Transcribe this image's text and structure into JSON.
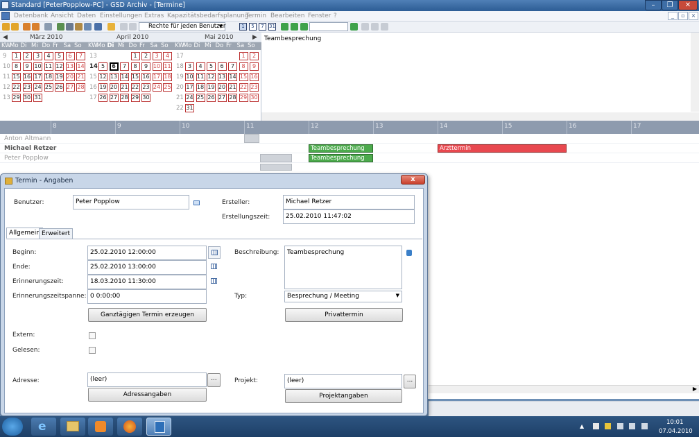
{
  "window": {
    "title": "Standard [PeterPopplow-PC] - GSD Archiv - [Termine]"
  },
  "menu": [
    "Datenbank",
    "Ansicht",
    "Daten",
    "Einstellungen",
    "Extras",
    "Kapazitätsbedarfsplanung",
    "Termin",
    "Bearbeiten",
    "Fenster",
    "?"
  ],
  "toolbar": {
    "rights_combo": "Rechte für jeden Benutzer",
    "view_buttons": [
      "1",
      "5",
      "7",
      "31"
    ]
  },
  "calendar": {
    "months": [
      "März 2010",
      "April 2010",
      "Mai 2010"
    ],
    "dow": [
      "KW",
      "Mo",
      "Di",
      "Mi",
      "Do",
      "Fr",
      "Sa",
      "So"
    ],
    "march": {
      "weeks": [
        "9",
        "10",
        "11",
        "12",
        "13"
      ],
      "rows": [
        [
          "",
          "1",
          "2",
          "3",
          "4",
          "5",
          "6",
          "7"
        ],
        [
          "",
          "8",
          "9",
          "10",
          "11",
          "12",
          "13",
          "14"
        ],
        [
          "",
          "15",
          "16",
          "17",
          "18",
          "19",
          "20",
          "21"
        ],
        [
          "",
          "22",
          "23",
          "24",
          "25",
          "26",
          "27",
          "28"
        ],
        [
          "",
          "29",
          "30",
          "31",
          "",
          "",
          "",
          ""
        ]
      ]
    },
    "april": {
      "weeks": [
        "13",
        "14",
        "15",
        "16",
        "17"
      ],
      "rows": [
        [
          "",
          "",
          "",
          "",
          "1",
          "2",
          "3",
          "4"
        ],
        [
          "",
          "5",
          "6",
          "7",
          "8",
          "9",
          "10",
          "11"
        ],
        [
          "",
          "12",
          "13",
          "14",
          "15",
          "16",
          "17",
          "18"
        ],
        [
          "",
          "19",
          "20",
          "21",
          "22",
          "23",
          "24",
          "25"
        ],
        [
          "",
          "26",
          "27",
          "28",
          "29",
          "30",
          "",
          ""
        ]
      ]
    },
    "may": {
      "weeks": [
        "17",
        "18",
        "19",
        "20",
        "21",
        "22"
      ],
      "rows": [
        [
          "",
          "",
          "",
          "",
          "",
          "",
          "1",
          "2"
        ],
        [
          "",
          "3",
          "4",
          "5",
          "6",
          "7",
          "8",
          "9"
        ],
        [
          "",
          "10",
          "11",
          "12",
          "13",
          "14",
          "15",
          "16"
        ],
        [
          "",
          "17",
          "18",
          "19",
          "20",
          "21",
          "22",
          "23"
        ],
        [
          "",
          "24",
          "25",
          "26",
          "27",
          "28",
          "29",
          "30"
        ],
        [
          "",
          "31",
          "",
          "",
          "",
          "",
          "",
          ""
        ]
      ]
    },
    "selected_day": "6",
    "selected_week": "14",
    "selected_dow": "Di"
  },
  "note": {
    "text": "Teambesprechung"
  },
  "schedule": {
    "hours": [
      "8",
      "9",
      "10",
      "11",
      "12",
      "13",
      "14",
      "15",
      "16",
      "17"
    ],
    "users": [
      "Anton Altmann",
      "Michael Retzer",
      "Peter Popplow"
    ],
    "appointments": [
      {
        "label": "Teambesprechung"
      },
      {
        "label": "Arzttermin"
      },
      {
        "label": "Teambesprechung"
      }
    ]
  },
  "dialog": {
    "title": "Termin - Angaben",
    "close": "x",
    "benutzer_label": "Benutzer:",
    "benutzer": "Peter Popplow",
    "ersteller_label": "Ersteller:",
    "ersteller": "Michael Retzer",
    "erstellungszeit_label": "Erstellungszeit:",
    "erstellungszeit": "25.02.2010 11:47:02",
    "tabs": [
      "Allgemein",
      "Erweitert"
    ],
    "beginn_label": "Beginn:",
    "beginn": "25.02.2010 12:00:00",
    "ende_label": "Ende:",
    "ende": "25.02.2010 13:00:00",
    "erinnerung_label": "Erinnerungszeit:",
    "erinnerung": "18.03.2010 11:30:00",
    "spanne_label": "Erinnerungszeitspanne:",
    "spanne": "0 0:00:00",
    "ganztag_button": "Ganztägigen Termin erzeugen",
    "beschreibung_label": "Beschreibung:",
    "beschreibung": "Teambesprechung",
    "typ_label": "Typ:",
    "typ": "Besprechung / Meeting",
    "privat_button": "Privattermin",
    "extern_label": "Extern:",
    "gelesen_label": "Gelesen:",
    "adresse_label": "Adresse:",
    "adresse": "(leer)",
    "adress_button": "Adressangaben",
    "projekt_label": "Projekt:",
    "projekt": "(leer)",
    "projekt_button": "Projektangaben",
    "dots": "..."
  },
  "taskbar": {
    "time": "10:01",
    "date": "07.04.2010"
  },
  "colors": {
    "appt_green": "#4caa4c",
    "appt_red": "#e8484f"
  }
}
